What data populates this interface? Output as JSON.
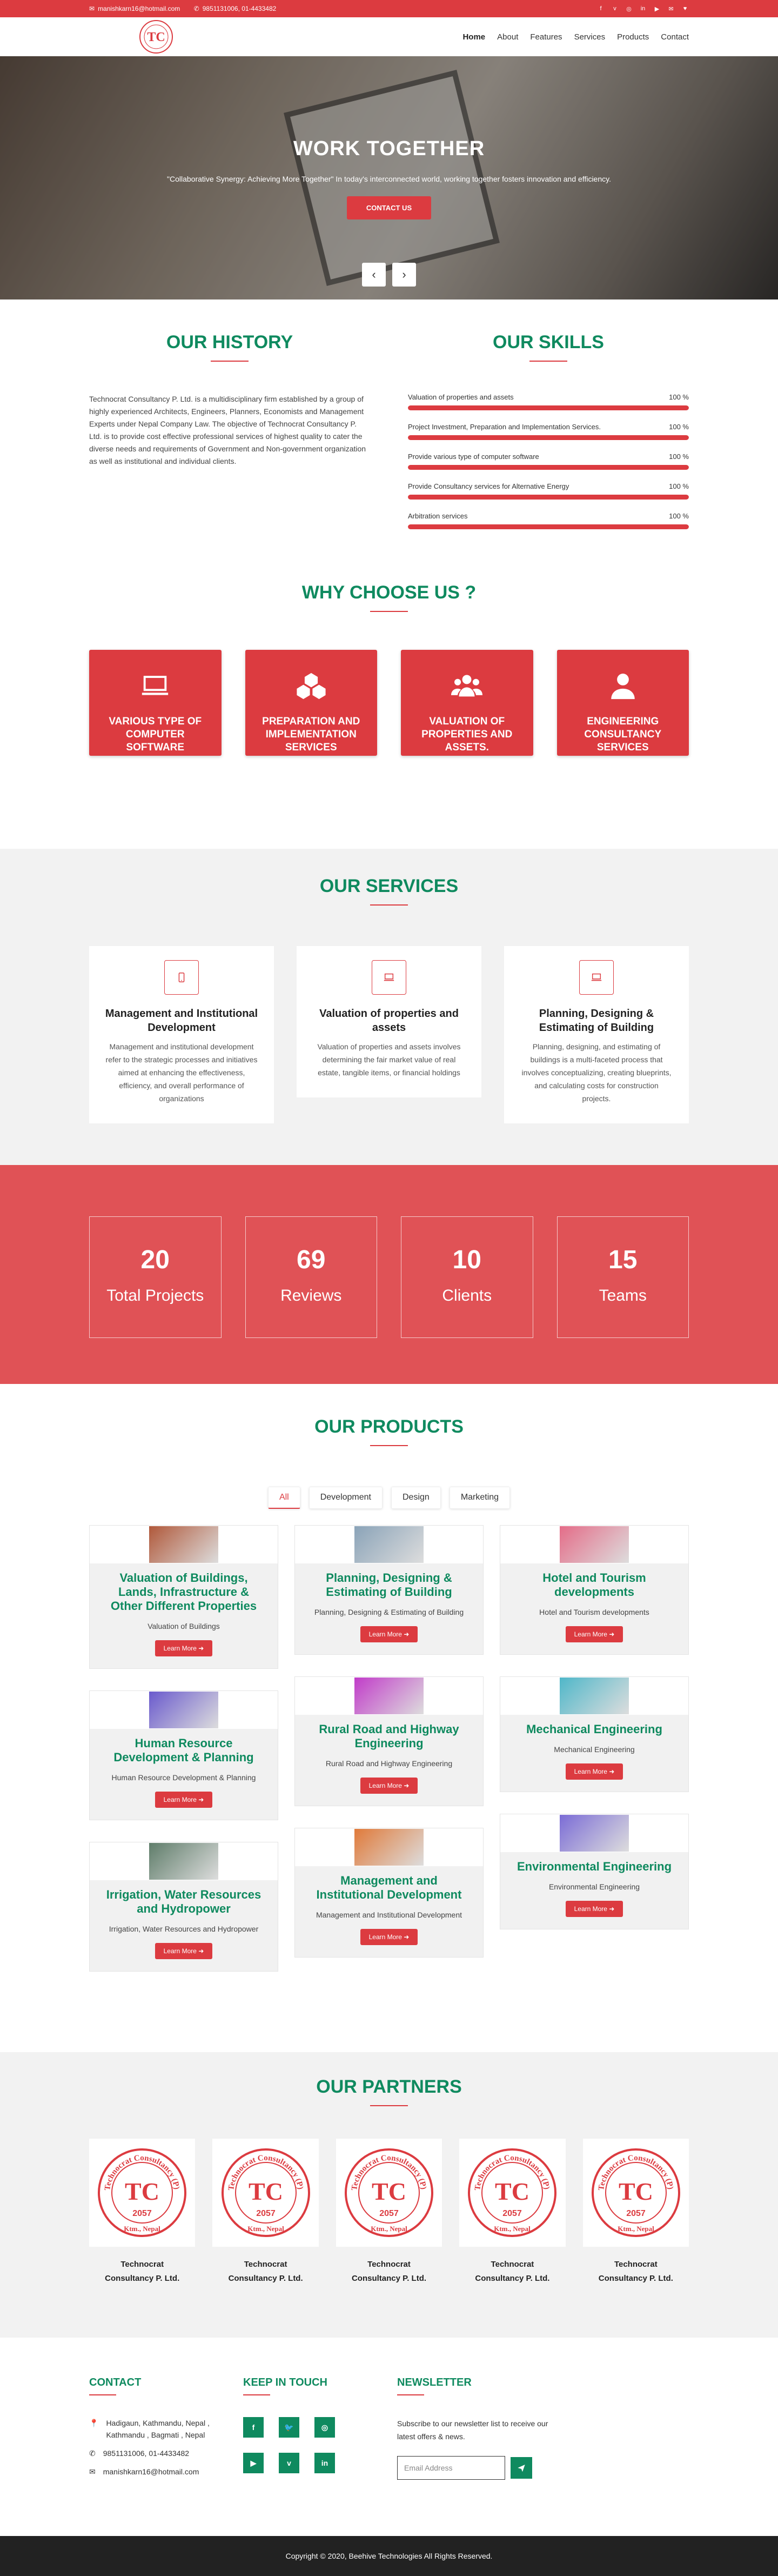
{
  "topbar": {
    "email": "manishkarn16@hotmail.com",
    "phone": "9851131006, 01-4433482",
    "social": [
      "f",
      "v",
      "◎",
      "in",
      "▶",
      "✉",
      "♥"
    ]
  },
  "nav": {
    "items": [
      "Home",
      "About",
      "Features",
      "Services",
      "Products",
      "Contact"
    ]
  },
  "hero": {
    "title": "WORK TOGETHER",
    "subtitle": "\"Collaborative Synergy: Achieving More Together\" In today's interconnected world, working together fosters innovation and efficiency.",
    "button": "CONTACT US",
    "prev": "‹",
    "next": "›"
  },
  "history": {
    "title": "OUR HISTORY",
    "text": "Technocrat Consultancy P. Ltd. is a multidisciplinary firm established by a group of highly experienced Architects, Engineers, Planners, Economists and Management Experts under Nepal Company Law. The objective of Technocrat Consultancy P. Ltd. is to provide cost effective professional services of highest quality to cater the diverse needs and requirements of Government and Non-government organization as well as institutional and individual clients."
  },
  "skills": {
    "title": "OUR SKILLS",
    "items": [
      {
        "label": "Valuation of properties and assets",
        "percent": "100 %",
        "value": 100
      },
      {
        "label": "Project Investment, Preparation and Implementation Services.",
        "percent": "100 %",
        "value": 100
      },
      {
        "label": "Provide various type of computer software",
        "percent": "100 %",
        "value": 100
      },
      {
        "label": "Provide Consultancy services for Alternative Energy",
        "percent": "100 %",
        "value": 100
      },
      {
        "label": "Arbitration services",
        "percent": "100 %",
        "value": 100
      }
    ]
  },
  "why": {
    "title": "WHY CHOOSE US ?",
    "cards": [
      {
        "label": "VARIOUS TYPE OF COMPUTER SOFTWARE",
        "icon": "laptop-icon"
      },
      {
        "label": "PREPARATION AND IMPLEMENTATION SERVICES",
        "icon": "cubes-icon"
      },
      {
        "label": "VALUATION OF PROPERTIES AND ASSETS.",
        "icon": "users-icon"
      },
      {
        "label": "ENGINEERING CONSULTANCY SERVICES",
        "icon": "user-icon"
      }
    ]
  },
  "services": {
    "title": "OUR SERVICES",
    "cards": [
      {
        "title": "Management and Institutional Development",
        "desc": "Management and institutional development refer to the strategic processes and initiatives aimed at enhancing the effectiveness, efficiency, and overall performance of organizations",
        "icon": "mobile-icon"
      },
      {
        "title": "Valuation of properties and assets",
        "desc": "Valuation of properties and assets involves determining the fair market value of real estate, tangible items, or financial holdings",
        "icon": "laptop-icon"
      },
      {
        "title": "Planning, Designing & Estimating of Building",
        "desc": "Planning, designing, and estimating of buildings is a multi-faceted process that involves conceptualizing, creating blueprints, and calculating costs for construction projects.",
        "icon": "laptop-icon"
      }
    ]
  },
  "stats": [
    {
      "num": "20",
      "label": "Total Projects"
    },
    {
      "num": "69",
      "label": "Reviews"
    },
    {
      "num": "10",
      "label": "Clients"
    },
    {
      "num": "15",
      "label": "Teams"
    }
  ],
  "products": {
    "title": "OUR PRODUCTS",
    "filters": [
      "All",
      "Development",
      "Design",
      "Marketing"
    ],
    "learn_more": "Learn More ➜",
    "columns": [
      [
        {
          "title": "Valuation of Buildings, Lands, Infrastructure & Other Different Properties",
          "sub": "Valuation of Buildings",
          "color": "#b0583a"
        },
        {
          "title": "Human Resource Development & Planning",
          "sub": "Human Resource Development & Planning",
          "color": "#6a5acd"
        },
        {
          "title": "Irrigation, Water Resources and Hydropower",
          "sub": "Irrigation, Water Resources and Hydropower",
          "color": "#5f7d6a"
        }
      ],
      [
        {
          "title": "Planning, Designing & Estimating of Building",
          "sub": "Planning, Designing & Estimating of Building",
          "color": "#8aa3b8"
        },
        {
          "title": "Rural Road and Highway Engineering",
          "sub": "Rural Road and Highway Engineering",
          "color": "#c13cc9"
        },
        {
          "title": "Management and Institutional Development",
          "sub": "Management and Institutional Development",
          "color": "#e07a3a"
        }
      ],
      [
        {
          "title": "Hotel and Tourism developments",
          "sub": "Hotel and Tourism developments",
          "color": "#e46c88"
        },
        {
          "title": "Mechanical Engineering",
          "sub": "Mechanical Engineering",
          "color": "#4fb7c9"
        },
        {
          "title": "Environmental Engineering",
          "sub": "Environmental Engineering",
          "color": "#7b6cd6"
        }
      ]
    ]
  },
  "partners": {
    "title": "OUR PARTNERS",
    "items": [
      {
        "name": "Technocrat Consultancy P. Ltd."
      },
      {
        "name": "Technocrat Consultancy P. Ltd."
      },
      {
        "name": "Technocrat Consultancy P. Ltd."
      },
      {
        "name": "Technocrat Consultancy P. Ltd."
      },
      {
        "name": "Technocrat Consultancy P. Ltd."
      }
    ],
    "seal_text": "Technocrat Consultancy (P) Ltd.",
    "seal_year": "2057",
    "seal_city": "Ktm., Nepal"
  },
  "footer": {
    "contact_title": "CONTACT",
    "address": "Hadigaun, Kathmandu, Nepal , Kathmandu , Bagmati , Nepal",
    "phone": "9851131006, 01-4433482",
    "email": "manishkarn16@hotmail.com",
    "touch_title": "KEEP IN TOUCH",
    "social": [
      "f",
      "🐦",
      "◎",
      "▶",
      "v",
      "in"
    ],
    "news_title": "NEWSLETTER",
    "news_text": "Subscribe to our newsletter list to receive our latest offers & news.",
    "news_placeholder": "Email Address",
    "copyright": "Copyright © 2020, Beehive Technologies All Rights Reserved."
  },
  "colors": {
    "brand_red": "#dc3b40",
    "brand_green": "#0f8a5f"
  }
}
